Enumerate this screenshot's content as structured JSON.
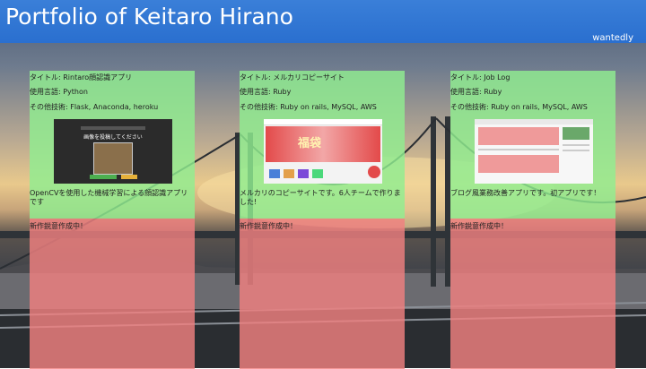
{
  "header": {
    "title": "Portfolio of Keitaro Hirano",
    "link": "wantedly"
  },
  "cards": [
    {
      "title": "タイトル: Rintaro顔認識アプリ",
      "language": "使用言語: Python",
      "tech": "その他技術: Flask, Anaconda, heroku",
      "description": "OpenCVを使用した機械学習による顔認識アプリです",
      "wip": "新作鋭意作成中！",
      "thumb_text": "画像を投稿してください"
    },
    {
      "title": "タイトル: メルカリコピーサイト",
      "language": "使用言語: Ruby",
      "tech": "その他技術: Ruby on rails, MySQL, AWS",
      "description": "メルカリのコピーサイトです。6人チームで作りました!",
      "wip": "新作鋭意作成中！",
      "thumb_text": "福袋"
    },
    {
      "title": "タイトル: Job Log",
      "language": "使用言語: Ruby",
      "tech": "その他技術: Ruby on rails, MySQL, AWS",
      "description": "ブログ風業務改善アプリです。初アプリです！",
      "wip": "新作鋭意作成中！"
    }
  ]
}
